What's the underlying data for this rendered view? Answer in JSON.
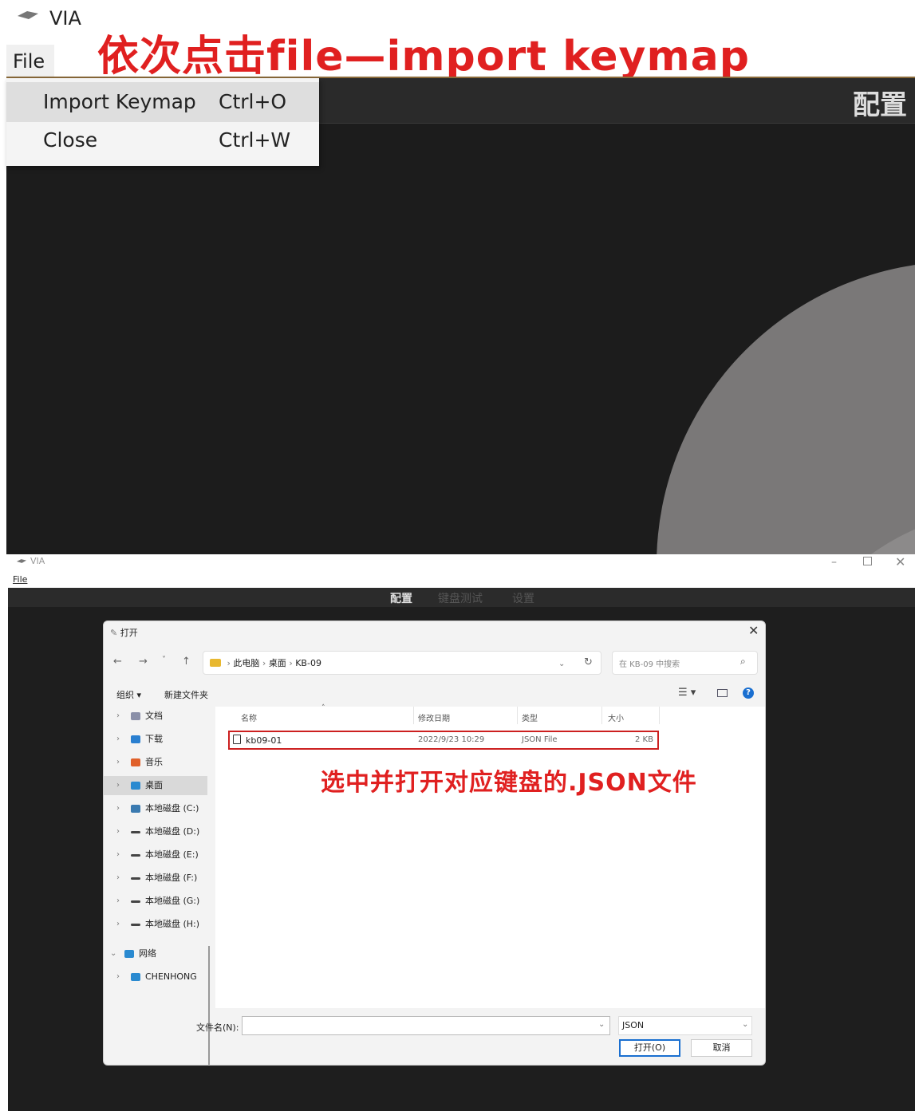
{
  "top": {
    "app_title": "VIA",
    "app_icon": "keyboard-icon",
    "menu_file": "File",
    "annotation": "依次点击file—import keymap",
    "header_title": "配置",
    "dropdown": [
      {
        "label": "Import Keymap",
        "shortcut": "Ctrl+O"
      },
      {
        "label": "Close",
        "shortcut": "Ctrl+W"
      }
    ]
  },
  "bottom": {
    "app_title": "VIA",
    "menu_file": "File",
    "window_controls": {
      "minimize": "–",
      "close": "✕"
    },
    "nav_tabs": [
      "配置",
      "键盘测试",
      "设置"
    ],
    "dialog": {
      "title": "打开",
      "close": "✕",
      "nav": {
        "back": "←",
        "forward": "→",
        "recent": "˅",
        "up": "↑"
      },
      "breadcrumb": [
        "此电脑",
        "桌面",
        "KB-09"
      ],
      "search_placeholder": "在 KB-09 中搜索",
      "toolbar": {
        "organize": "组织 ▾",
        "new_folder": "新建文件夹"
      },
      "sidebar": [
        {
          "label": "文档",
          "icon": "document-icon",
          "color": "#8a8fa8"
        },
        {
          "label": "下载",
          "icon": "download-icon",
          "color": "#2a7fd0"
        },
        {
          "label": "音乐",
          "icon": "music-icon",
          "color": "#e0602a"
        },
        {
          "label": "桌面",
          "icon": "desktop-icon",
          "color": "#2a8ad0"
        },
        {
          "label": "本地磁盘 (C:)",
          "icon": "drive-icon",
          "color": "#3a7ab0"
        },
        {
          "label": "本地磁盘 (D:)",
          "icon": "drive-icon",
          "color": "#444444"
        },
        {
          "label": "本地磁盘 (E:)",
          "icon": "drive-icon",
          "color": "#444444"
        },
        {
          "label": "本地磁盘 (F:)",
          "icon": "drive-icon",
          "color": "#444444"
        },
        {
          "label": "本地磁盘 (G:)",
          "icon": "drive-icon",
          "color": "#444444"
        },
        {
          "label": "本地磁盘 (H:)",
          "icon": "drive-icon",
          "color": "#444444"
        },
        {
          "label": "网络",
          "icon": "network-icon",
          "color": "#2a8ad0"
        },
        {
          "label": "CHENHONG",
          "icon": "computer-icon",
          "color": "#2a8ad0"
        }
      ],
      "columns": [
        "名称",
        "修改日期",
        "类型",
        "大小"
      ],
      "file": {
        "name": "kb09-01",
        "date": "2022/9/23 10:29",
        "type": "JSON File",
        "size": "2 KB"
      },
      "annotation": "选中并打开对应键盘的.JSON文件",
      "filename_label": "文件名(N):",
      "filename_value": "",
      "filetype": "JSON",
      "open_button": "打开(O)",
      "cancel_button": "取消"
    }
  },
  "colors": {
    "annotation": "#e02020",
    "accent": "#1a6fd0",
    "dark_bg": "#1c1c1c"
  }
}
